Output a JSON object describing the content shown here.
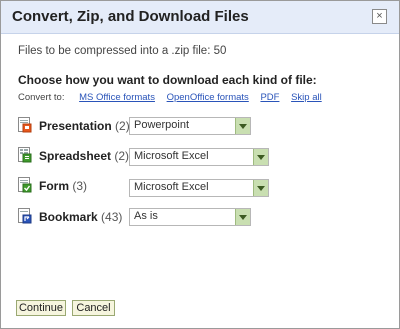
{
  "dialog": {
    "title": "Convert, Zip, and Download Files",
    "close_label": "×",
    "files_text": "Files to be compressed into a .zip file: 50",
    "choose_text": "Choose how you want to download each kind of file:",
    "convert_to_label": "Convert to:",
    "convert_links": [
      "MS Office formats",
      "OpenOffice formats",
      "PDF",
      "Skip all"
    ]
  },
  "kinds": [
    {
      "name": "Presentation",
      "count": "(2)",
      "selected": "Powerpoint",
      "icon": "presentation-icon",
      "color": "#e8581c"
    },
    {
      "name": "Spreadsheet",
      "count": "(2)",
      "selected": "Microsoft Excel",
      "icon": "spreadsheet-icon",
      "color": "#3e9a2c"
    },
    {
      "name": "Form",
      "count": "(3)",
      "selected": "Microsoft Excel",
      "icon": "form-icon",
      "color": "#3e9a2c"
    },
    {
      "name": "Bookmark",
      "count": "(43)",
      "selected": "As is",
      "icon": "bookmark-icon",
      "color": "#2a54b9"
    }
  ],
  "buttons": {
    "continue_label": "Continue",
    "cancel_label": "Cancel"
  }
}
